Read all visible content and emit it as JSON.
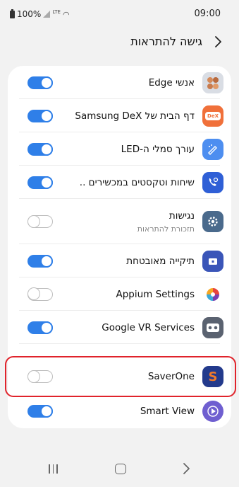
{
  "status_bar": {
    "battery_text": "100%",
    "network_label": "LTE",
    "time": "09:00"
  },
  "header": {
    "title": "גישה להתראות",
    "back_icon": "chevron-right-icon"
  },
  "apps": [
    {
      "label": "אנשי Edge",
      "subtitle": "",
      "enabled": true,
      "icon": "edge-people-icon",
      "icon_color": "#d9dde4"
    },
    {
      "label": "דף הבית של Samsung DeX",
      "subtitle": "",
      "enabled": true,
      "icon": "dex-icon",
      "icon_color": "#f0703a",
      "icon_text": "DeX"
    },
    {
      "label": "עורך סמלי ה-LED",
      "subtitle": "",
      "enabled": true,
      "icon": "led-editor-icon",
      "icon_color": "#4d8ef0"
    },
    {
      "label": "שיחות וטקסטים במכשירים ..",
      "subtitle": "",
      "enabled": true,
      "icon": "call-text-icon",
      "icon_color": "#2f5fd6"
    },
    {
      "label": "נגישות",
      "subtitle": "תזכורת להתראות",
      "enabled": false,
      "icon": "accessibility-gear-icon",
      "icon_color": "#4a6a8c"
    },
    {
      "label": "תיקייה מאובטחת",
      "subtitle": "",
      "enabled": true,
      "icon": "secure-folder-icon",
      "icon_color": "#3a55b8"
    },
    {
      "label": "Appium Settings",
      "subtitle": "",
      "enabled": false,
      "icon": "appium-icon",
      "icon_color": "#ffffff"
    },
    {
      "label": "Google VR Services",
      "subtitle": "",
      "enabled": true,
      "icon": "vr-icon",
      "icon_color": "#5a6270"
    },
    {
      "label": "SaverOne",
      "subtitle": "",
      "enabled": false,
      "icon": "saverone-icon",
      "icon_color": "#233a8c",
      "icon_text": "S"
    },
    {
      "label": "Smart View",
      "subtitle": "",
      "enabled": true,
      "icon": "smart-view-icon",
      "icon_color": "#6f5fd0"
    }
  ],
  "colors": {
    "toggle_on": "#2f7fe8",
    "highlight": "#e0232b"
  },
  "nav_bar": {
    "recents_icon": "recents-icon",
    "home_icon": "home-icon",
    "back_icon": "back-icon"
  }
}
